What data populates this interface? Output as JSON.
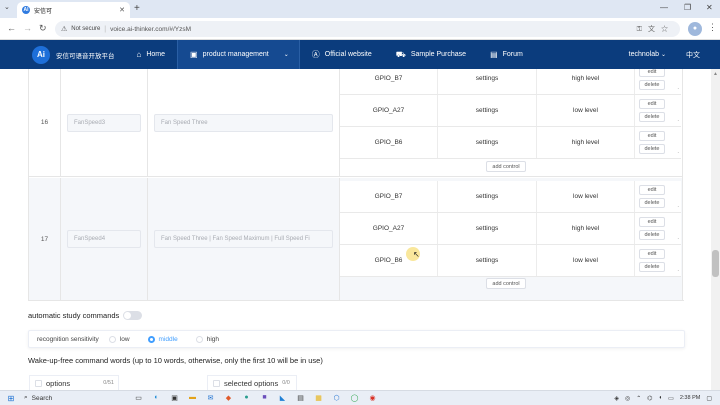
{
  "browser": {
    "tab_title": "安信可",
    "tab_favicon_text": "AI",
    "not_secure": "Not secure",
    "url": "voice.ai-thinker.com/#/YzsM"
  },
  "navbar": {
    "logo_text": "Ai",
    "brand": "安信可语音开放平台",
    "items": [
      {
        "label": "Home",
        "icon": "home-icon"
      },
      {
        "label": "product management",
        "icon": "box-icon"
      },
      {
        "label": "Official website",
        "icon": "ai-icon"
      },
      {
        "label": "Sample Purchase",
        "icon": "cart-icon"
      },
      {
        "label": "Forum",
        "icon": "forum-icon"
      }
    ],
    "user": "technolab",
    "language": "中文"
  },
  "table": {
    "rows": [
      {
        "id": "16",
        "name_placeholder": "FanSpeed3",
        "phrase_placeholder": "Fan Speed Three",
        "controls": [
          {
            "gpio": "GPIO_B7",
            "settings": "settings",
            "level": "high level"
          },
          {
            "gpio": "GPIO_A27",
            "settings": "settings",
            "level": "low level"
          },
          {
            "gpio": "GPIO_B6",
            "settings": "settings",
            "level": "high level"
          }
        ]
      },
      {
        "id": "17",
        "name_placeholder": "FanSpeed4",
        "phrase_placeholder": "Fan Speed Three | Fan Speed Maximum | Full Speed Fi",
        "controls": [
          {
            "gpio": "GPIO_B7",
            "settings": "settings",
            "level": "low level"
          },
          {
            "gpio": "GPIO_A27",
            "settings": "settings",
            "level": "high level"
          },
          {
            "gpio": "GPIO_B6",
            "settings": "settings",
            "level": "low level"
          }
        ]
      }
    ],
    "edit_label": "edit",
    "delete_label": "delete",
    "add_control_label": "add control"
  },
  "study": {
    "label": "automatic study commands",
    "enabled": false
  },
  "sensitivity": {
    "label": "recognition sensitivity",
    "options": [
      "low",
      "middle",
      "high"
    ],
    "selected": "middle"
  },
  "wakeup": {
    "title": "Wake-up-free command words (up to 10 words, otherwise, only the first 10 will be in use)",
    "options_label": "options",
    "options_count": "0/51",
    "selected_label": "selected options",
    "selected_count": "0/0"
  },
  "taskbar": {
    "search": "Search",
    "time": "2:38 PM"
  }
}
